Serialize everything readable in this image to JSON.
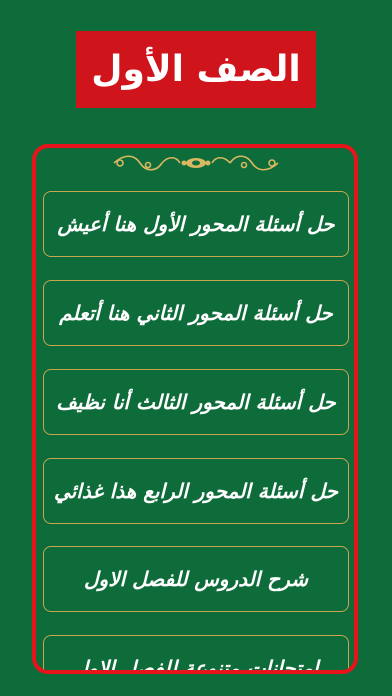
{
  "header": {
    "title": "الصف الأول"
  },
  "menu": {
    "items": [
      {
        "label": "حل أسئلة المحور الأول هنا أعيش"
      },
      {
        "label": "حل أسئلة المحور الثاني هنا أتعلم"
      },
      {
        "label": "حل أسئلة المحور الثالث أنا نظيف"
      },
      {
        "label": "حل أسئلة المحور الرابع هذا غذائي"
      },
      {
        "label": "شرح الدروس للفصل الاول"
      },
      {
        "label": "امتحانات متنوعة للفصل الاول"
      }
    ]
  },
  "colors": {
    "background": "#0e6b3a",
    "banner": "#d0141c",
    "frame": "#e8141c",
    "item_border": "#c9a64e",
    "ornament": "#d8b860"
  },
  "icons": {
    "ornament": "decorative-divider-icon"
  }
}
